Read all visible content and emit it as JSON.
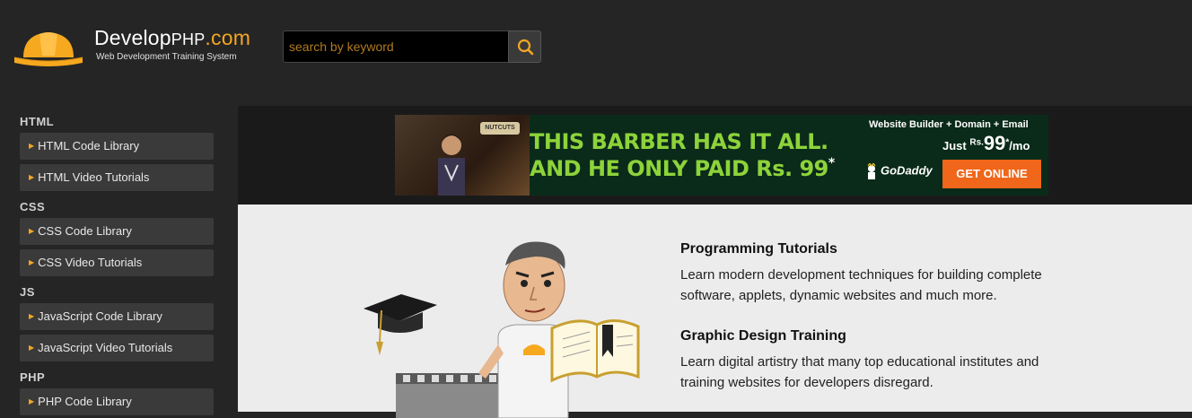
{
  "header": {
    "brand_main": "Develop",
    "brand_php": "PHP",
    "brand_com": ".com",
    "tagline": "Web Development Training System",
    "search_placeholder": "search by keyword",
    "search_icon": "search-icon"
  },
  "sidebar": {
    "sections": [
      {
        "heading": "HTML",
        "items": [
          "HTML Code Library",
          "HTML Video Tutorials"
        ]
      },
      {
        "heading": "CSS",
        "items": [
          "CSS Code Library",
          "CSS Video Tutorials"
        ]
      },
      {
        "heading": "JS",
        "items": [
          "JavaScript Code Library",
          "JavaScript Video Tutorials"
        ]
      },
      {
        "heading": "PHP",
        "items": [
          "PHP Code Library"
        ]
      }
    ]
  },
  "ad": {
    "sign": "NUTCUTS",
    "headline1": "THIS BARBER HAS IT ALL.",
    "headline2": "AND HE ONLY PAID Rs. 99",
    "asterisk": "*",
    "right_top": "Website Builder + Domain + Email",
    "price_just": "Just ",
    "price_rs": "Rs.",
    "price_value": "99",
    "price_unit": "/mo",
    "brand": "GoDaddy",
    "cta": "GET ONLINE"
  },
  "main": {
    "sections": [
      {
        "title": "Programming Tutorials",
        "text1": "Learn modern development techniques for building complete",
        "text2": "software, applets, dynamic websites and much more."
      },
      {
        "title": "Graphic Design Training",
        "text1": "Learn digital artistry that many top educational institutes and",
        "text2": "training websites for developers disregard."
      }
    ]
  },
  "colors": {
    "accent": "#f4a623",
    "background": "#252525",
    "content_bg": "#ececec",
    "ad_green": "#8dd33a",
    "ad_orange": "#f0661a"
  }
}
